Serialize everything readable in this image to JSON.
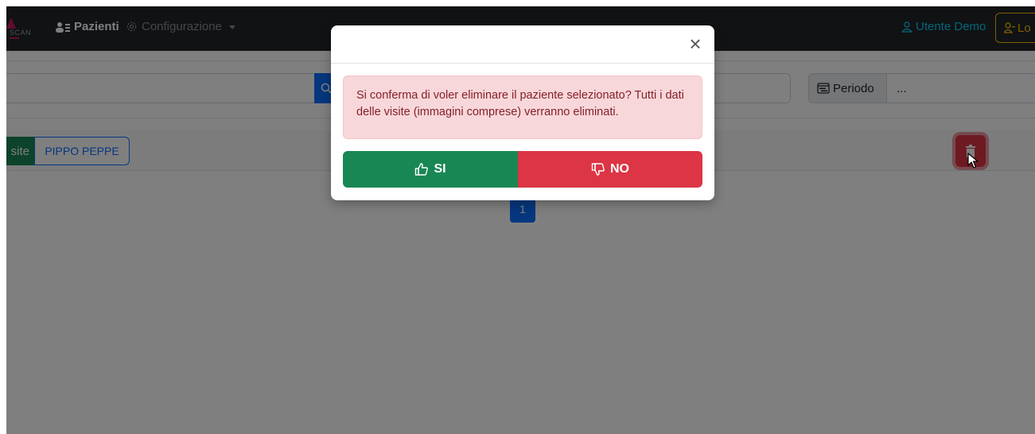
{
  "navbar": {
    "logo_text": "SCAN",
    "pazienti_label": "Pazienti",
    "configurazione_label": "Configurazione",
    "user_label": "Utente Demo",
    "logout_label": "Lo"
  },
  "filters": {
    "periodo_label": "Periodo",
    "periodo_value": "..."
  },
  "patient_bar": {
    "visite_label": "site",
    "patient_name": "PIPPO PEPPE"
  },
  "pagination": {
    "current_page": "1"
  },
  "modal": {
    "close_symbol": "×",
    "message": "Si conferma di voler eliminare il paziente selezionato? Tutti i dati delle visite (immagini comprese) verranno eliminati.",
    "yes_label": "SI",
    "no_label": "NO"
  },
  "colors": {
    "navbar": "#212529",
    "primary": "#0d6efd",
    "success": "#198754",
    "danger": "#dc3545",
    "warning": "#ffc107",
    "info": "#0dcaf0",
    "alert_bg": "#f8d7da",
    "alert_text": "#842029"
  }
}
